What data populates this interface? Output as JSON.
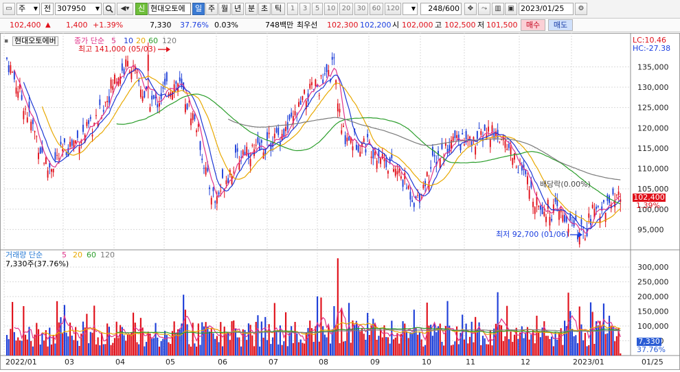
{
  "toolbar": {
    "period_dropdown": "주",
    "board_dropdown": "전",
    "code": "307950",
    "search_icon": "search-icon",
    "sound_icon": "speaker-icon",
    "new_badge": "신",
    "stock_name": "현대오토에",
    "periods": [
      "일",
      "주",
      "월",
      "년",
      "분",
      "초",
      "틱"
    ],
    "selected_period": "일",
    "intervals": [
      "1",
      "3",
      "5",
      "10",
      "20",
      "30",
      "60",
      "120"
    ],
    "bar_count": "248",
    "bar_total": "/600",
    "date": "2023/01/25"
  },
  "quote": {
    "price": "102,400",
    "change_arrow": "▲",
    "change": "1,400",
    "change_pct": "+1.39%",
    "volume": "7,330",
    "volume_ratio": "37.76%",
    "turnover": "0.03%",
    "amount": "748백만",
    "hoga_label": "최우선",
    "best_ask": "102,300",
    "best_bid": "102,200",
    "open_label": "시",
    "open": "102,000",
    "high_label": "고",
    "high": "102,500",
    "low_label": "저",
    "low": "101,500",
    "buy_label": "매수",
    "sell_label": "매도"
  },
  "price_panel": {
    "title": "현대오토에버",
    "ma_title": "종가 단순",
    "ma_periods": [
      "5",
      "10",
      "20",
      "60",
      "120"
    ],
    "ma_colors": [
      "#e0338a",
      "#1d38d4",
      "#e8a800",
      "#2a9d2a",
      "#7a7a7a"
    ],
    "lc": "LC:10.46",
    "hc": "HC:-27.38",
    "high_annotation": "최고 141,000 (05/03)",
    "low_annotation": "최저 92,700 (01/06)",
    "dividend_annotation": "배당락(0.00%)",
    "current_price_tag": "102,400",
    "current_pct_tag": "1.39%",
    "y_ticks": [
      "135,000",
      "130,000",
      "125,000",
      "120,000",
      "115,000",
      "110,000",
      "105,000",
      "100,000",
      "95,000"
    ]
  },
  "volume_panel": {
    "title": "거래량 단순",
    "ma_periods": [
      "5",
      "20",
      "60",
      "120"
    ],
    "ma_colors": [
      "#e0338a",
      "#e8a800",
      "#2a9d2a",
      "#7a7a7a"
    ],
    "current_text": "7,330주(37.76%)",
    "current_tag": "7,330",
    "current_pct_tag": "37.76%",
    "y_ticks": [
      "300,000",
      "250,000",
      "200,000",
      "150,000",
      "100,000",
      "50,000"
    ]
  },
  "x_axis": {
    "ticks": [
      "2022/01",
      "03",
      "04",
      "05",
      "06",
      "07",
      "08",
      "09",
      "10",
      "11",
      "12",
      "2023/01"
    ],
    "right_label": "01/25"
  },
  "chart_data": {
    "type": "candlestick",
    "unit": "KRW",
    "y_price_range": [
      90000,
      143000
    ],
    "y_volume_range": [
      0,
      340000
    ],
    "start": "2022/01",
    "end": "2023/01/25",
    "monthly_guide": [
      {
        "month": "2022/01",
        "close_range": [
          108000,
          138000
        ]
      },
      {
        "month": "2022/03",
        "close_range": [
          113000,
          120000
        ]
      },
      {
        "month": "2022/04",
        "close_range": [
          120000,
          136000
        ]
      },
      {
        "month": "2022/05",
        "close_range": [
          125000,
          141000
        ]
      },
      {
        "month": "2022/06",
        "close_range": [
          102000,
          128000
        ]
      },
      {
        "month": "2022/07",
        "close_range": [
          108000,
          120000
        ]
      },
      {
        "month": "2022/08",
        "close_range": [
          118000,
          137000
        ]
      },
      {
        "month": "2022/09",
        "close_range": [
          112000,
          118000
        ]
      },
      {
        "month": "2022/10",
        "close_range": [
          101000,
          116000
        ]
      },
      {
        "month": "2022/11",
        "close_range": [
          111000,
          120000
        ]
      },
      {
        "month": "2022/12",
        "close_range": [
          96000,
          113000
        ]
      },
      {
        "month": "2023/01",
        "close_range": [
          92700,
          103000
        ]
      }
    ],
    "max_high": {
      "value": 141000,
      "date": "05/03"
    },
    "min_low": {
      "value": 92700,
      "date": "01/06"
    },
    "last_close": 102400,
    "last_volume": 7330,
    "max_volume": 330000
  }
}
